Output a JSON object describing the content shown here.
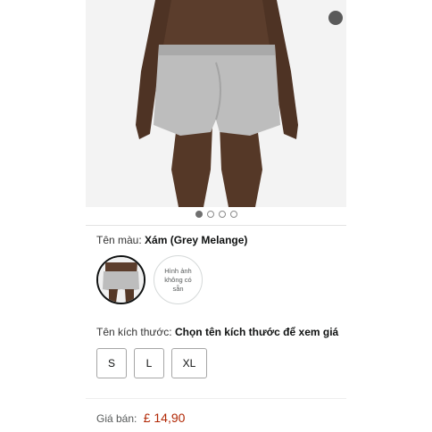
{
  "product": {
    "image_alt": "product-photo",
    "carousel": {
      "count": 4,
      "active": 0
    }
  },
  "color": {
    "label": "Tên màu:",
    "value": "Xám (Grey Melange)",
    "unavailable_text": "Hình ảnh không có sẵn"
  },
  "size": {
    "label": "Tên kích thước:",
    "value": "Chọn tên kích thước để xem giá",
    "options": [
      "S",
      "L",
      "XL"
    ]
  },
  "price": {
    "label": "Giá bán:",
    "value": "£ 14,90",
    "color": "#b12704"
  }
}
